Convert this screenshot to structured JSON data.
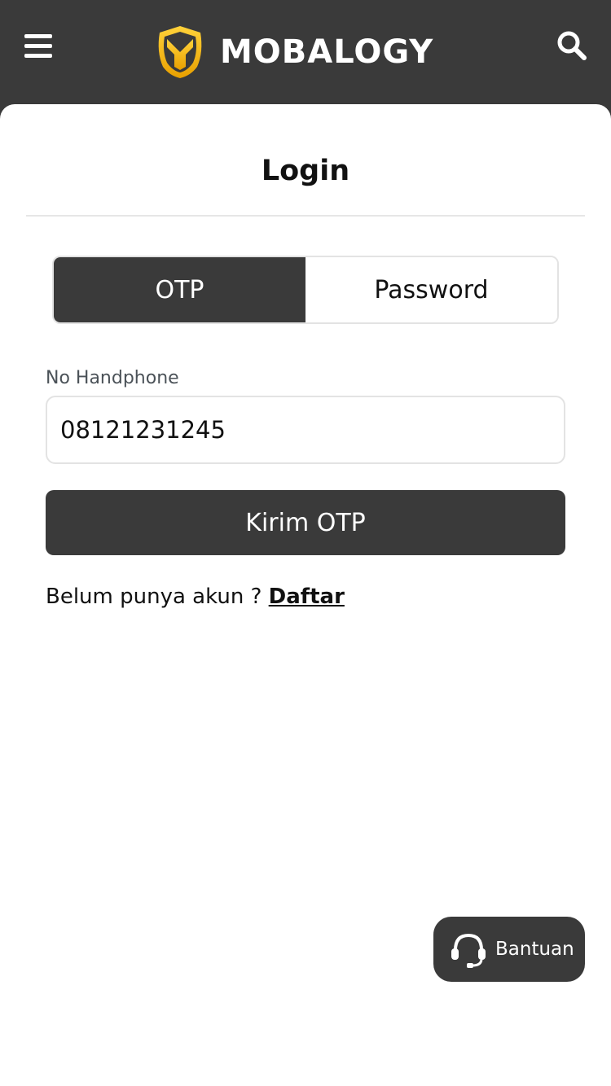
{
  "header": {
    "brand": "MOBALOGY",
    "icons": {
      "menu": "hamburger-menu-icon",
      "logo": "helmet-shield-logo",
      "search": "search-icon"
    }
  },
  "login": {
    "title": "Login",
    "tabs": [
      {
        "label": "OTP",
        "active": true
      },
      {
        "label": "Password",
        "active": false
      }
    ],
    "phone": {
      "label": "No Handphone",
      "value": "08121231245"
    },
    "submit_label": "Kirim OTP",
    "register_prompt": "Belum punya akun ?",
    "register_link": "Daftar"
  },
  "help": {
    "label": "Bantuan",
    "icon": "headset-icon"
  },
  "colors": {
    "primary_dark": "#3a3a3a",
    "logo_gold": "#f5b301",
    "background": "#ffffff",
    "border": "#e3e3e3"
  }
}
